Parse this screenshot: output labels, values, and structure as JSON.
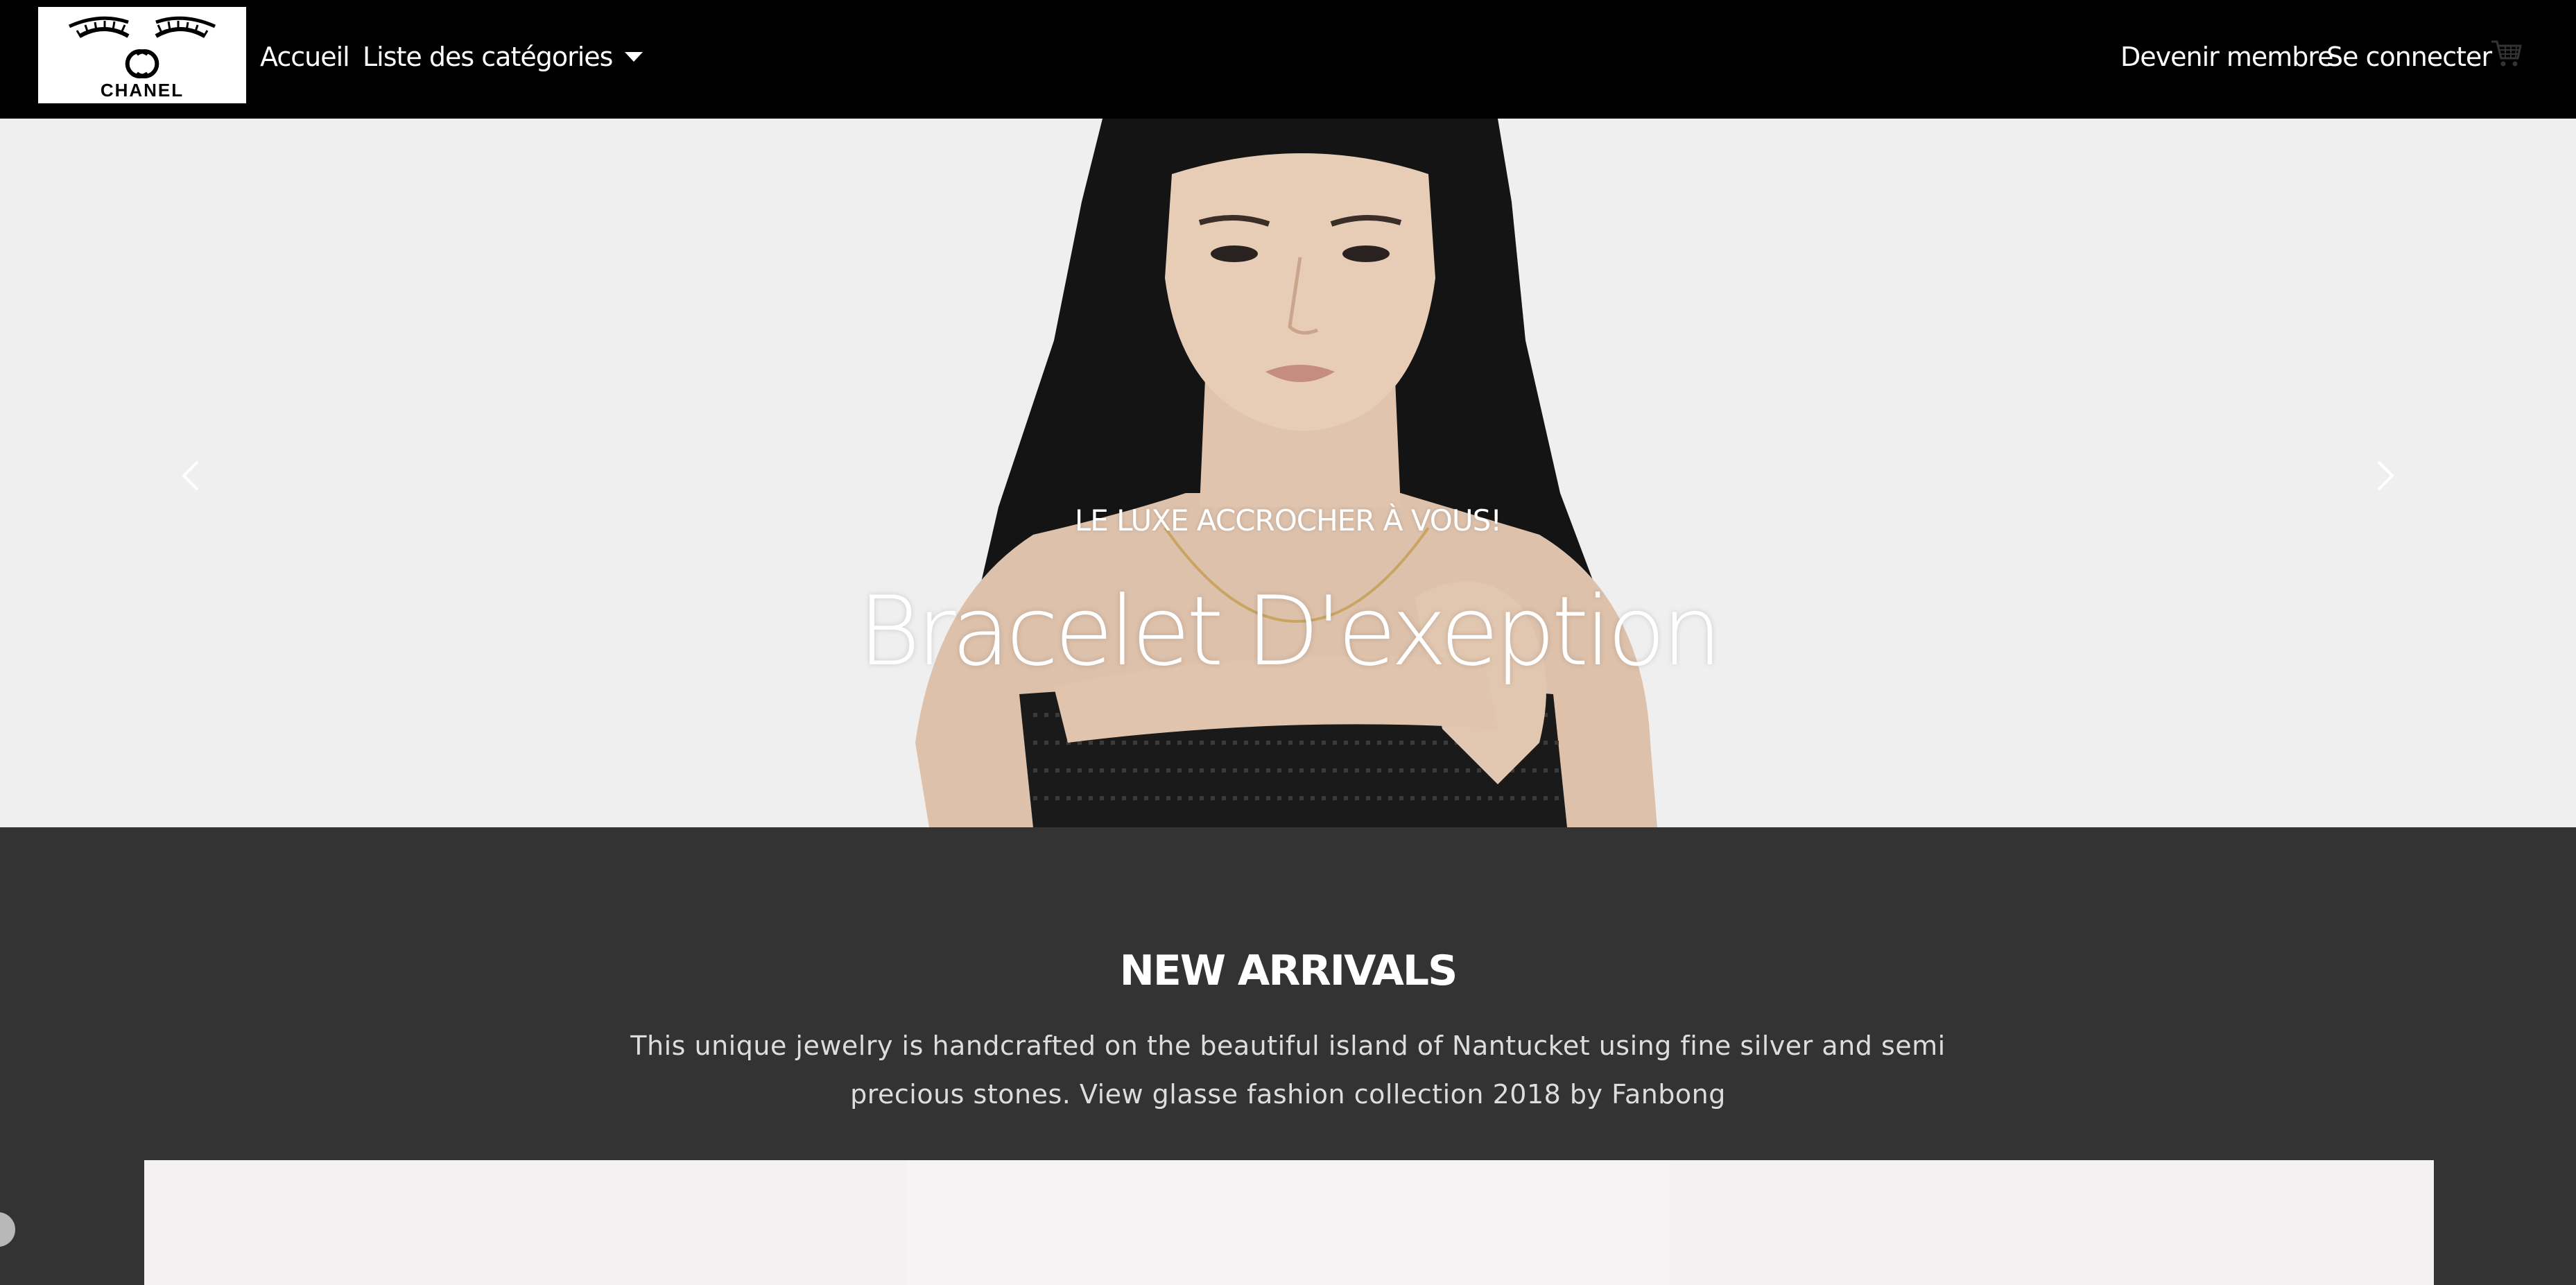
{
  "navbar": {
    "logo_text": "CHANEL",
    "home_label": "Accueil",
    "categories_label": "Liste des catégories",
    "become_member_label": "Devenir membre",
    "login_label": "Se connecter",
    "cart_icon": "shopping-cart-icon"
  },
  "hero": {
    "caption": "LE LUXE ACCROCHER À VOUS!",
    "title": "Bracelet D'exeption",
    "prev_icon": "chevron-left-icon",
    "next_icon": "chevron-right-icon"
  },
  "arrivals": {
    "title": "NEW ARRIVALS",
    "description": "This unique jewelry is handcrafted on the beautiful island of Nantucket using fine silver and semi precious stones. View glasse fashion collection 2018 by Fanbong"
  },
  "colors": {
    "navbar_bg": "#000000",
    "hero_bg": "#efefef",
    "section_bg": "#333333",
    "text_light": "#ffffff"
  }
}
